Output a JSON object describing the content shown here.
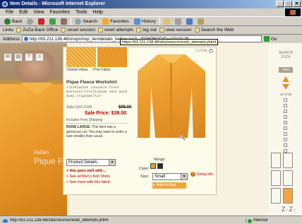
{
  "window": {
    "title": "Item Details - Microsoft Internet Explorer",
    "minimize": "_",
    "maximize": "□",
    "close": "✕"
  },
  "menu": [
    "File",
    "Edit",
    "View",
    "Favorites",
    "Tools",
    "Help"
  ],
  "toolbar": {
    "back": "Back",
    "forward": "→",
    "stop": "",
    "refresh": "",
    "home": "",
    "search": "Search",
    "favorites": "Favorites",
    "history": "History"
  },
  "links": [
    "Links",
    "ZoZa Back Office",
    "unset session",
    "reset attempts",
    "log out",
    "view session",
    "Search the Web"
  ],
  "address": {
    "label": "Address",
    "url": "http://63.211.138.48/shop/shop_itemdetails_before.jsp?...3006PRODID=11010126",
    "go": "Go"
  },
  "tooltip_url": "https://63.211.138.48/zbo/source/reset_attempts.jhtml",
  "side": {
    "italian": "Italian",
    "pique": "Pique Fl"
  },
  "panel": {
    "close": "CLOSE",
    "detail_views": ">Detail Views",
    "the_fabric": ">The Fabric",
    "product_name": "Pique Fleece Workshirt",
    "description": "<li>Placket conceals front buttons</li><li>Side vent with ZoZa trigram</li>",
    "style": "Style:1101-0126",
    "orig_price": "$98.00",
    "sale_price": "Sale Price: $39.00",
    "free_shipping": "Includes Free Shipping",
    "runs_large_bold": "RUNS LARGE:",
    "runs_large_text": "This item has a generous cut. You may want to order a size smaller than usual.",
    "product_details": "Product Details:",
    "goes_well": "> this goes well with...",
    "see_knit": "> See all Men's Knit Shirts",
    "see_fabric": "> See more with this fabric",
    "color_name": "Mango",
    "color_label": "Color:",
    "size_label": "Size:",
    "size_value": "Small",
    "sizing_info": "Sizing info",
    "add_to_bag": "Add to Bag",
    "zoom": "🔍"
  },
  "right_nav": {
    "search": "SEARCH ZOZA",
    "men": "men",
    "count": "10 of 30"
  },
  "brand": "Z·Z·",
  "status": {
    "url": "http://63.211.138.48/zbo/source/reset_attempts.jhtml",
    "zone": "Internet"
  },
  "colors": {
    "accent": "#e8932c",
    "sale": "#b00000",
    "titlebar": "#0a246a"
  }
}
